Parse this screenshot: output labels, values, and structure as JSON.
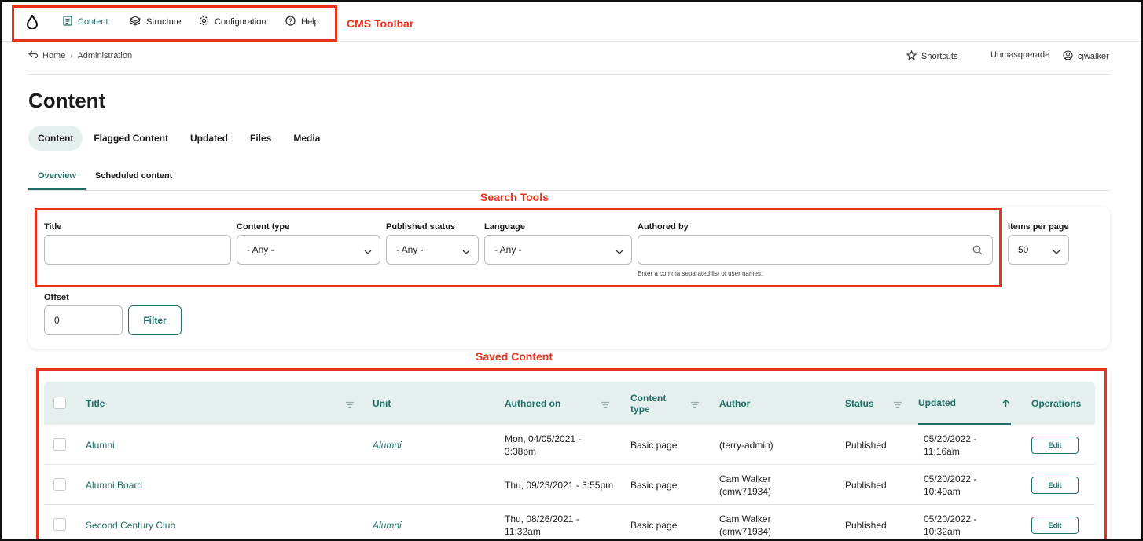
{
  "toolbar": {
    "items": [
      {
        "label": "Content",
        "icon": "document-icon"
      },
      {
        "label": "Structure",
        "icon": "layers-icon"
      },
      {
        "label": "Configuration",
        "icon": "gear-icon"
      },
      {
        "label": "Help",
        "icon": "help-icon"
      }
    ],
    "annotation": "CMS Toolbar"
  },
  "breadcrumb": {
    "home": "Home",
    "separator": "/",
    "current": "Administration"
  },
  "user_menu": {
    "shortcuts": "Shortcuts",
    "unmasquerade": "Unmasquerade",
    "username": "cjwalker"
  },
  "page_title": "Content",
  "tabs": [
    "Content",
    "Flagged Content",
    "Updated",
    "Files",
    "Media"
  ],
  "subtabs": [
    "Overview",
    "Scheduled content"
  ],
  "search": {
    "annotation": "Search Tools",
    "title_label": "Title",
    "title_value": "",
    "content_type_label": "Content type",
    "content_type_value": "- Any -",
    "published_label": "Published status",
    "published_value": "- Any -",
    "language_label": "Language",
    "language_value": "- Any -",
    "authored_label": "Authored by",
    "authored_value": "",
    "authored_hint": "Enter a comma separated list of user names.",
    "items_label": "Items per page",
    "items_value": "50",
    "offset_label": "Offset",
    "offset_value": "0",
    "filter_button": "Filter"
  },
  "table": {
    "annotation": "Saved Content",
    "columns": {
      "title": "Title",
      "unit": "Unit",
      "authored_on": "Authored on",
      "content_type": "Content type",
      "author": "Author",
      "status": "Status",
      "updated": "Updated",
      "operations": "Operations"
    },
    "rows": [
      {
        "title": "Alumni",
        "unit": "Alumni",
        "authored_on": "Mon, 04/05/2021 - 3:38pm",
        "content_type": "Basic page",
        "author": "(terry-admin)",
        "status": "Published",
        "updated": "05/20/2022 - 11:16am",
        "operation": "Edit"
      },
      {
        "title": "Alumni Board",
        "unit": "",
        "authored_on": "Thu, 09/23/2021 - 3:55pm",
        "content_type": "Basic page",
        "author": "Cam Walker (cmw71934)",
        "status": "Published",
        "updated": "05/20/2022 - 10:49am",
        "operation": "Edit"
      },
      {
        "title": "Second Century Club",
        "unit": "Alumni",
        "authored_on": "Thu, 08/26/2021 - 11:32am",
        "content_type": "Basic page",
        "author": "Cam Walker (cmw71934)",
        "status": "Published",
        "updated": "05/20/2022 - 10:32am",
        "operation": "Edit"
      }
    ]
  },
  "colors": {
    "accent": "#1f6f68",
    "annotation": "#e8331c",
    "header_bg": "#e4efee"
  }
}
